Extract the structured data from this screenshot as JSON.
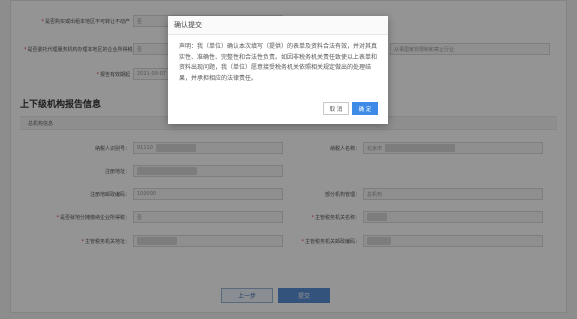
{
  "form": {
    "upper": {
      "row1": {
        "label": "是否购买或出租本地区不可转让不动产",
        "value": "否"
      },
      "row2": {
        "label": "是否委托代理服务机构办理本地区的企业所得税汇算",
        "value": "否",
        "right_value": "从事国家非限制和禁止行业"
      },
      "row3": {
        "label": "报告有效期起",
        "value": "2021-09-07"
      }
    },
    "section_title": "上下级机构报告信息",
    "subsection_title": "总机构信息",
    "fields": {
      "tax_id": {
        "label": "纳税人识别号：",
        "value": "91110"
      },
      "taxpayer_name": {
        "label": "纳税人名称：",
        "value": "北京市"
      },
      "reg_address": {
        "label": "注册地址：",
        "value": ""
      },
      "reg_postcode": {
        "label": "注册地邮政编码：",
        "value": "100000"
      },
      "dept_area": {
        "label": "部分机构管理：",
        "value": "总机构"
      },
      "is_main_tax": {
        "label": "是否就地分摊缴纳企业所得税：",
        "value": "否"
      },
      "tax_authority": {
        "label": "主管税务机关名称：",
        "value": ""
      },
      "tax_auth_address": {
        "label": "主管税务机关地址：",
        "value": ""
      },
      "tax_auth_postcode": {
        "label": "主管税务机关邮政编码：",
        "value": ""
      }
    }
  },
  "buttons": {
    "prev": "上一步",
    "submit": "提交"
  },
  "modal": {
    "title": "确认提交",
    "body": "声明：我（单位）确认本次填写（提供）的表单及资料合法有效，并对其真实性、准确性、完整性和合法性负责。如因非税务机关责任致使以上表单和资料出现问题，我（单位）愿意接受税务机关依照相关规定做出的处理结果，并承担相应的法律责任。",
    "cancel": "取 消",
    "ok": "确 定"
  }
}
